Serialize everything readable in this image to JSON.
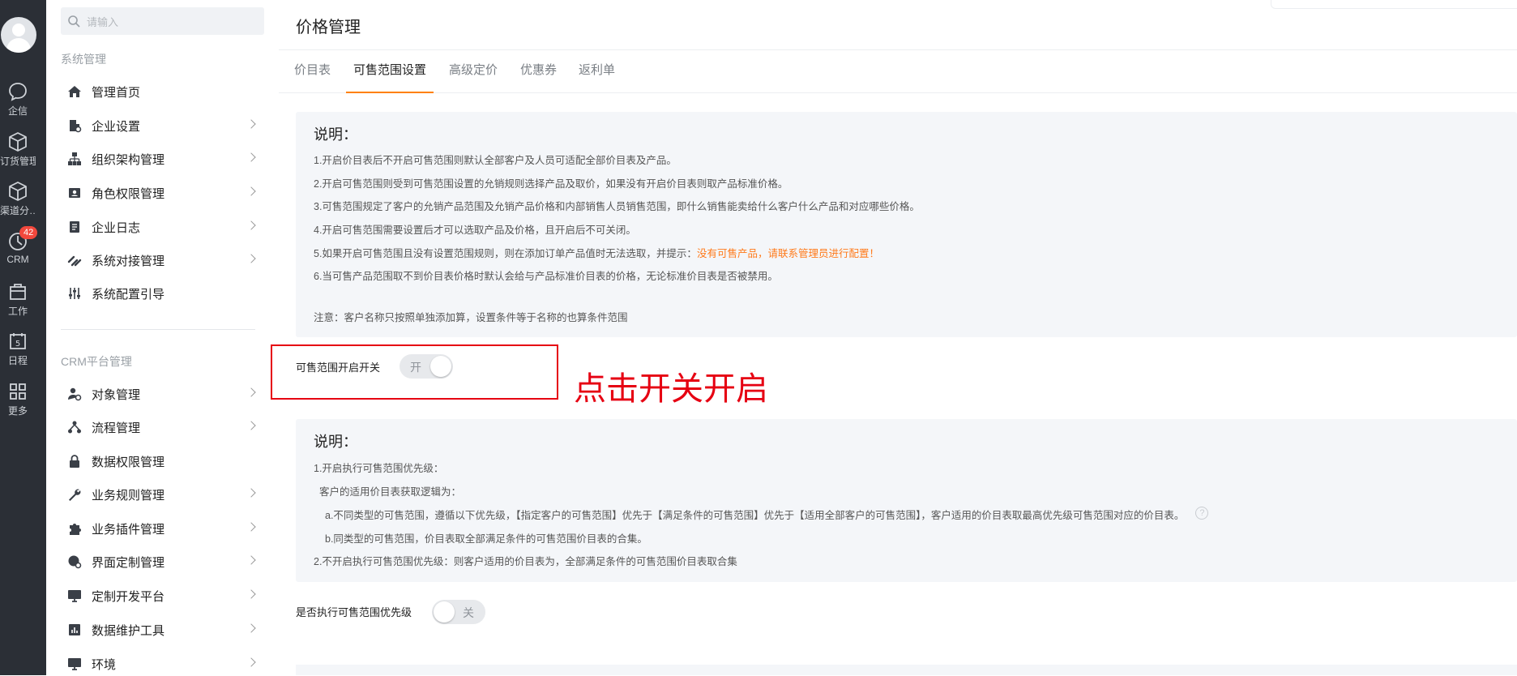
{
  "rail": {
    "items": [
      {
        "label": "企信",
        "icon": "chat-icon"
      },
      {
        "label": "订货管理",
        "icon": "box-icon"
      },
      {
        "label": "渠道分…",
        "icon": "box-icon"
      },
      {
        "label": "CRM",
        "icon": "crm-icon",
        "badge": "42"
      },
      {
        "label": "工作",
        "icon": "briefcase-icon"
      },
      {
        "label": "日程",
        "icon": "calendar-icon",
        "day": "5"
      },
      {
        "label": "更多",
        "icon": "grid-icon"
      }
    ]
  },
  "menu": {
    "search_placeholder": "请输入",
    "section_system": "系统管理",
    "section_crm": "CRM平台管理",
    "system_items": [
      {
        "label": "管理首页",
        "icon": "home-icon"
      },
      {
        "label": "企业设置",
        "icon": "building-icon"
      },
      {
        "label": "组织架构管理",
        "icon": "org-chart-icon"
      },
      {
        "label": "角色权限管理",
        "icon": "id-card-icon"
      },
      {
        "label": "企业日志",
        "icon": "log-icon"
      },
      {
        "label": "系统对接管理",
        "icon": "link-icon"
      },
      {
        "label": "系统配置引导",
        "icon": "sliders-icon"
      }
    ],
    "crm_items": [
      {
        "label": "对象管理",
        "icon": "user-gear-icon"
      },
      {
        "label": "流程管理",
        "icon": "flow-icon"
      },
      {
        "label": "数据权限管理",
        "icon": "lock-icon"
      },
      {
        "label": "业务规则管理",
        "icon": "wrench-icon"
      },
      {
        "label": "业务插件管理",
        "icon": "puzzle-icon"
      },
      {
        "label": "界面定制管理",
        "icon": "palette-icon"
      },
      {
        "label": "定制开发平台",
        "icon": "monitor-icon"
      },
      {
        "label": "数据维护工具",
        "icon": "bar-chart-icon"
      },
      {
        "label": "环境",
        "icon": "monitor-icon"
      }
    ]
  },
  "main": {
    "title": "价格管理",
    "tabs": [
      "价目表",
      "可售范围设置",
      "高级定价",
      "优惠券",
      "返利单"
    ],
    "active_tab": 1,
    "note1": {
      "title": "说明：",
      "line1": "1.开启价目表后不开启可售范围则默认全部客户及人员可适配全部价目表及产品。",
      "line2": "2.开启可售范围则受到可售范围设置的允销规则选择产品及取价，如果没有开启价目表则取产品标准价格。",
      "line3": "3.可售范围规定了客户的允销产品范围及允销产品价格和内部销售人员销售范围，即什么销售能卖给什么客户什么产品和对应哪些价格。",
      "line4": "4.开启可售范围需要设置后才可以选取产品及价格，且开启后不可关闭。",
      "line5_prefix": "5.如果开启可售范围且没有设置范围规则，则在添加订单产品值时无法选取，并提示：",
      "line5_highlight": "没有可售产品，请联系管理员进行配置！",
      "line6": "6.当可售产品范围取不到价目表价格时默认会给与产品标准价目表的价格，无论标准价目表是否被禁用。",
      "remark": "注意：客户名称只按照单独添加算，设置条件等于名称的也算条件范围"
    },
    "switch1": {
      "label": "可售范围开启开关",
      "state": "开"
    },
    "annotation": "点击开关开启",
    "note2": {
      "title": "说明：",
      "line1": "1.开启执行可售范围优先级：",
      "line2": "客户的适用价目表获取逻辑为：",
      "line3": "a.不同类型的可售范围，遵循以下优先级，【指定客户的可售范围】优先于【满足条件的可售范围】优先于【适用全部客户的可售范围】，客户适用的价目表取最高优先级可售范围对应的价目表。",
      "help": "?",
      "line4": "b.同类型的可售范围，价目表取全部满足条件的可售范围价目表的合集。",
      "line5": "2.不开启执行可售范围优先级：则客户适用的价目表为，全部满足条件的可售范围价目表取合集"
    },
    "switch2": {
      "label": "是否执行可售范围优先级",
      "state": "关"
    }
  }
}
